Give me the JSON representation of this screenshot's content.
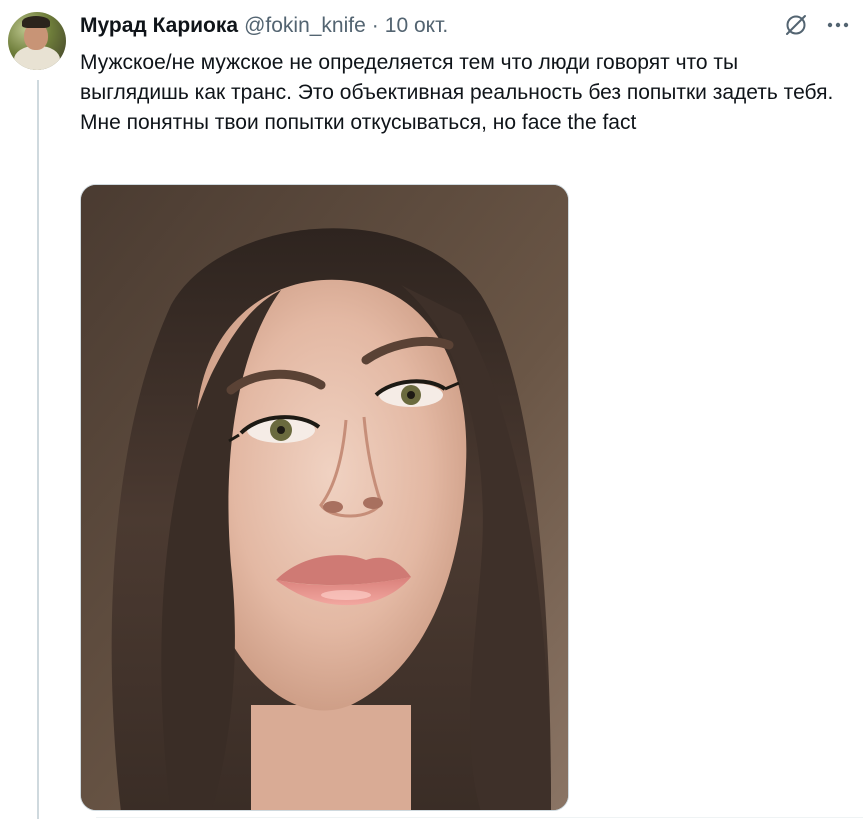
{
  "tweet": {
    "author_name": "Мурад Кариока",
    "author_handle": "@fokin_knife",
    "separator": "·",
    "date": "10 окт.",
    "text_lines": [
      "Мужское/не мужское не определяется тем что люди говорят что ты выглядишь как транс. Это объективная реальность без попытки задеть тебя.",
      "Мне понятны твои попытки откусываться, но face the fact"
    ],
    "media": {
      "type": "photo",
      "icon": "photo-selfie"
    }
  },
  "icons": {
    "grok": "slash-circle-icon",
    "more": "more-dots-icon"
  },
  "colors": {
    "text_primary": "#0f1419",
    "text_secondary": "#536471",
    "border": "#cfd9de"
  }
}
